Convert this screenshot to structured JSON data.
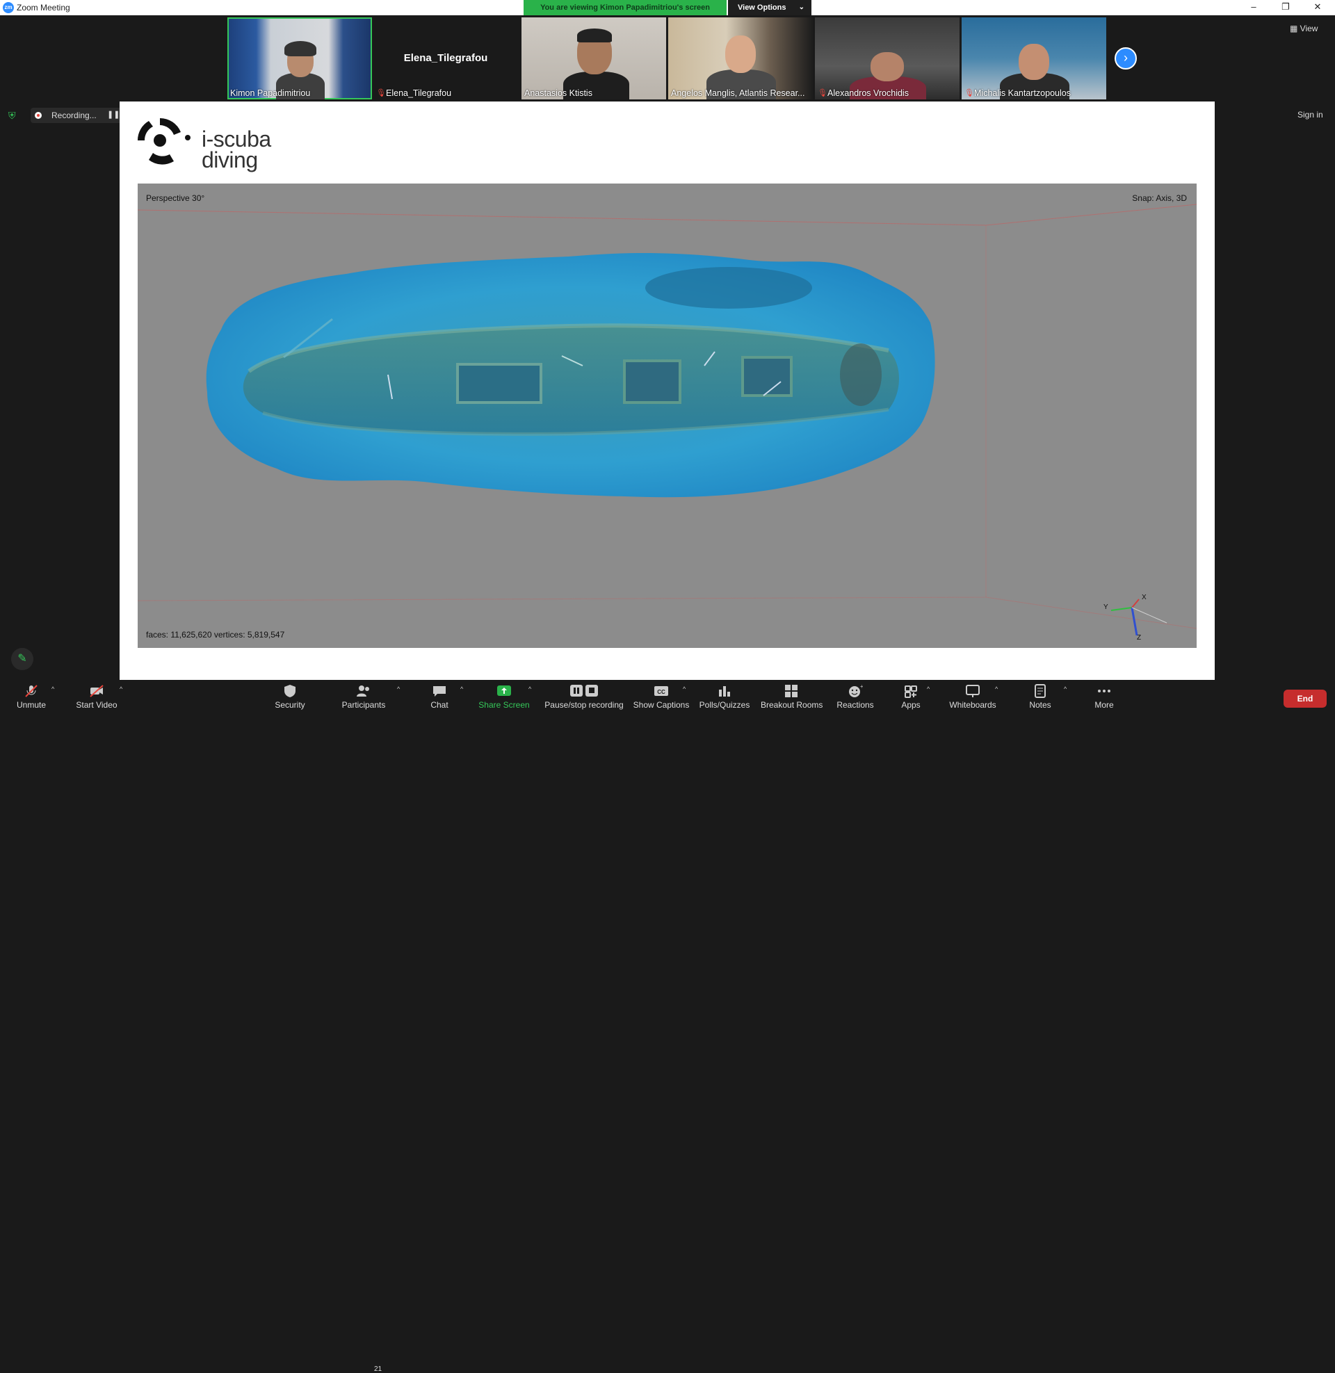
{
  "window": {
    "title": "Zoom Meeting",
    "app_icon": "zm"
  },
  "banner": {
    "viewing_text": "You are viewing Kimon Papadimitriou's screen",
    "view_options_label": "View Options"
  },
  "filmstrip": {
    "participants": [
      {
        "name": "Kimon Papadimitriou",
        "muted": false,
        "active": true
      },
      {
        "name": "Elena_Tilegrafou",
        "muted": true,
        "video": false,
        "display_name": "Elena_Tilegrafou"
      },
      {
        "name": "Anastasios Ktistis",
        "muted": false
      },
      {
        "name": "Angelos Manglis, Atlantis Resear...",
        "muted": false
      },
      {
        "name": "Alexandros Vrochidis",
        "muted": true
      },
      {
        "name": "Michalis Kantartzopoulos",
        "muted": true
      }
    ],
    "view_label": "View"
  },
  "status": {
    "recording_label": "Recording...",
    "sign_in": "Sign in"
  },
  "shared_screen": {
    "logo_line1": "i-scuba",
    "logo_line2": "diving",
    "viewport": {
      "perspective": "Perspective 30°",
      "snap": "Snap: Axis, 3D",
      "stats": "faces: 11,625,620 vertices: 5,819,547",
      "axes": {
        "x": "X",
        "y": "Y",
        "z": "Z"
      }
    }
  },
  "toolbar": {
    "unmute": "Unmute",
    "start_video": "Start Video",
    "security": "Security",
    "participants": "Participants",
    "participants_count": "21",
    "chat": "Chat",
    "share_screen": "Share Screen",
    "pause_stop": "Pause/stop recording",
    "show_captions": "Show Captions",
    "polls": "Polls/Quizzes",
    "breakout": "Breakout Rooms",
    "reactions": "Reactions",
    "apps": "Apps",
    "whiteboards": "Whiteboards",
    "notes": "Notes",
    "more": "More",
    "end": "End"
  },
  "colors": {
    "share_green": "#2ab24a",
    "accent_blue": "#2d8cff",
    "end_red": "#c62d2d",
    "scan_blue": "#2f9fd0"
  }
}
